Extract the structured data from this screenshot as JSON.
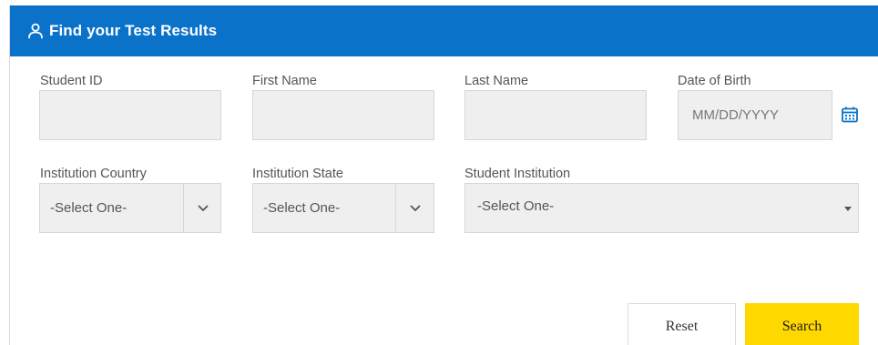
{
  "header": {
    "title": "Find your Test Results",
    "icon": "user-icon",
    "color": "#0a72c9"
  },
  "fields": {
    "student_id": {
      "label": "Student ID",
      "value": ""
    },
    "first_name": {
      "label": "First Name",
      "value": ""
    },
    "last_name": {
      "label": "Last Name",
      "value": ""
    },
    "date_of_birth": {
      "label": "Date of Birth",
      "placeholder": "MM/DD/YYYY",
      "icon": "calendar-icon"
    },
    "institution_country": {
      "label": "Institution Country",
      "selected": "-Select One-"
    },
    "institution_state": {
      "label": "Institution State",
      "selected": "-Select One-"
    },
    "student_institution": {
      "label": "Student Institution",
      "selected": "-Select One-"
    }
  },
  "buttons": {
    "reset": "Reset",
    "search": "Search",
    "search_color": "#ffd800"
  }
}
